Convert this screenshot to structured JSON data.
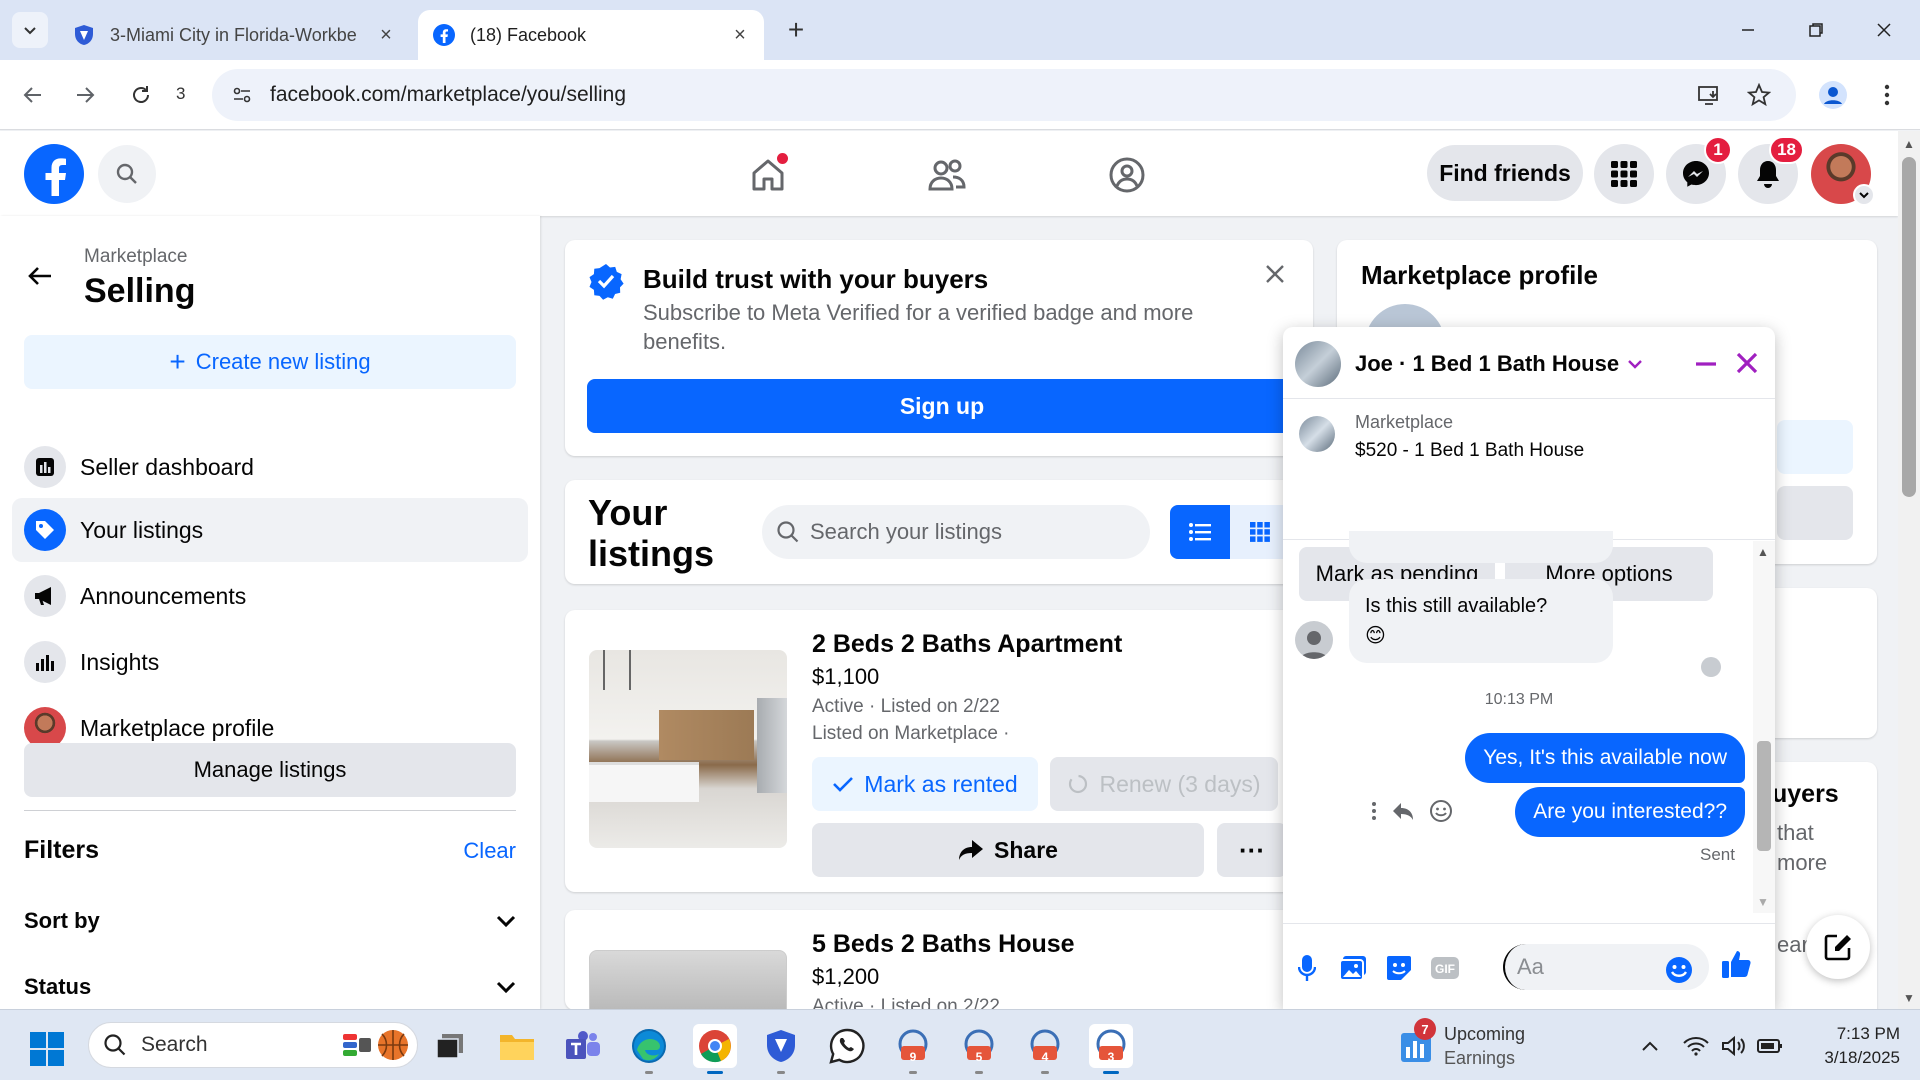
{
  "browser": {
    "tabs": [
      {
        "title": "3-Miami City in Florida-Workbe",
        "active": false
      },
      {
        "title": "(18) Facebook",
        "active": true
      }
    ],
    "url": "facebook.com/marketplace/you/selling",
    "extension_count": "3"
  },
  "fb_nav": {
    "find_friends": "Find friends",
    "messenger_badge": "1",
    "notifications_badge": "18"
  },
  "sidebar": {
    "breadcrumb": "Marketplace",
    "title": "Selling",
    "create_listing": "Create new listing",
    "items": [
      {
        "label": "Seller dashboard",
        "icon": "dashboard-icon"
      },
      {
        "label": "Your listings",
        "icon": "tag-icon"
      },
      {
        "label": "Announcements",
        "icon": "megaphone-icon"
      },
      {
        "label": "Insights",
        "icon": "bar-chart-icon"
      },
      {
        "label": "Marketplace profile",
        "icon": "profile-avatar"
      }
    ],
    "manage_listings": "Manage listings",
    "filters_label": "Filters",
    "clear_label": "Clear",
    "filter_rows": [
      "Sort by",
      "Status"
    ]
  },
  "trust_card": {
    "title": "Build trust with your buyers",
    "subtitle": "Subscribe to Meta Verified for a verified badge and more benefits.",
    "button": "Sign up"
  },
  "listings": {
    "title": "Your listings",
    "search_placeholder": "Search your listings",
    "items": [
      {
        "title": "2 Beds 2 Baths Apartment",
        "price": "$1,100",
        "status": "Active · Listed on 2/22",
        "listed_on": "Listed on Marketplace ·",
        "mark_button": "Mark as rented",
        "renew_button": "Renew (3 days)",
        "share_button": "Share",
        "more_button": "···"
      },
      {
        "title": "5 Beds 2 Baths House",
        "price": "$1,200",
        "status": "Active · Listed on 2/22"
      }
    ]
  },
  "right_panel": {
    "profile_title": "Marketplace profile",
    "card3_title": "uyers",
    "card3_line1": "that",
    "card3_line2": "more",
    "card3_line3": "ear"
  },
  "chat": {
    "name": "Joe · 1 Bed 1 Bath House",
    "context_label": "Marketplace",
    "context_item": "$520 - 1 Bed 1 Bath House",
    "mark_pending": "Mark as pending",
    "more_options": "More options",
    "incoming_message": "Is this still available?",
    "incoming_emoji": "😊",
    "time": "10:13 PM",
    "outgoing_1": "Yes, It's this available now",
    "outgoing_2": "Are you interested??",
    "status": "Sent",
    "input_placeholder": "Aa"
  },
  "taskbar": {
    "search_label": "Search",
    "upcoming_title": "Upcoming",
    "upcoming_sub": "Earnings",
    "upcoming_badge": "7",
    "app_numbers": [
      "9",
      "5",
      "4",
      "3"
    ],
    "time": "7:13 PM",
    "date": "3/18/2025"
  },
  "colors": {
    "fb_blue": "#0866ff",
    "badge_red": "#e41e3f",
    "messenger_purple": "#a020c0"
  }
}
